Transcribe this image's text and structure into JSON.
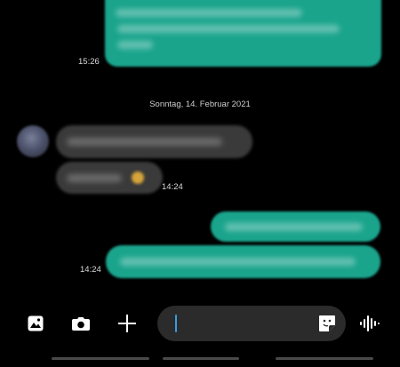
{
  "conversation": {
    "messages": [
      {
        "direction": "outgoing",
        "time": "15:26"
      },
      {
        "direction": "incoming"
      },
      {
        "direction": "incoming",
        "time": "14:24"
      },
      {
        "direction": "outgoing"
      },
      {
        "direction": "outgoing",
        "time": "14:24"
      }
    ],
    "date_separator": "Sonntag, 14. Februar 2021"
  },
  "composer": {
    "value": "",
    "icons": {
      "gallery": "image-icon",
      "camera": "camera-icon",
      "attach": "plus-icon",
      "sticker": "sticker-icon",
      "voice": "voice-wave-icon"
    }
  },
  "colors": {
    "outgoing_bubble": "#1aa48c",
    "incoming_bubble": "#3a3a3a",
    "background": "#000000",
    "composer": "#2b2b2b",
    "caret": "#3a9be0"
  }
}
